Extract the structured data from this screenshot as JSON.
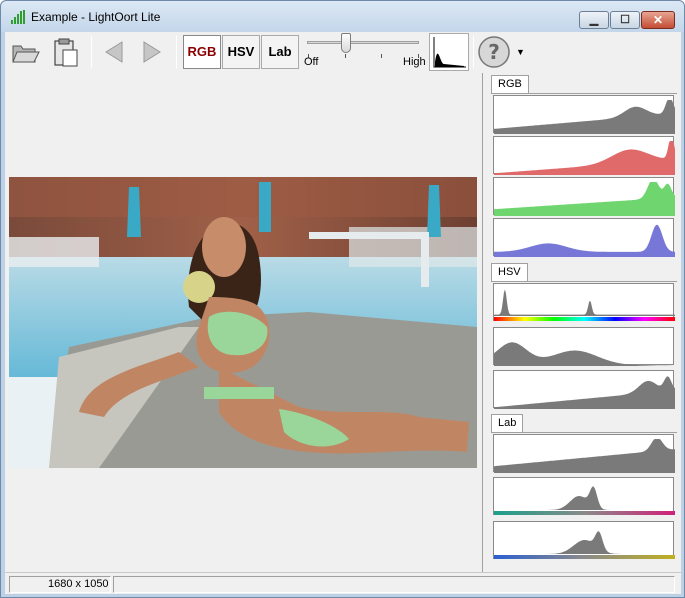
{
  "window": {
    "title": "Example - LightOort Lite",
    "min_glyph": "▁",
    "max_glyph": "☐",
    "close_glyph": "✕"
  },
  "toolbar": {
    "modes": [
      "RGB",
      "HSV",
      "Lab"
    ],
    "active_mode": "RGB",
    "slider_min_label": "Off",
    "slider_max_label": "High",
    "slider_value_percent": 35,
    "help_glyph": "?",
    "dropdown_glyph": "▼"
  },
  "panel": {
    "groups": [
      {
        "tab": "RGB",
        "channels": [
          "luminance",
          "red",
          "green",
          "blue"
        ]
      },
      {
        "tab": "HSV",
        "channels": [
          "hue",
          "saturation",
          "value"
        ]
      },
      {
        "tab": "Lab",
        "channels": [
          "lightness",
          "a",
          "b"
        ]
      }
    ]
  },
  "status": {
    "dimensions": "1680 x 1050",
    "message": ""
  },
  "colors": {
    "hist_gray": "#7a7a7a",
    "hist_red": "#e06a6a",
    "hist_green": "#6fd56f",
    "hist_blue": "#7777d8"
  }
}
